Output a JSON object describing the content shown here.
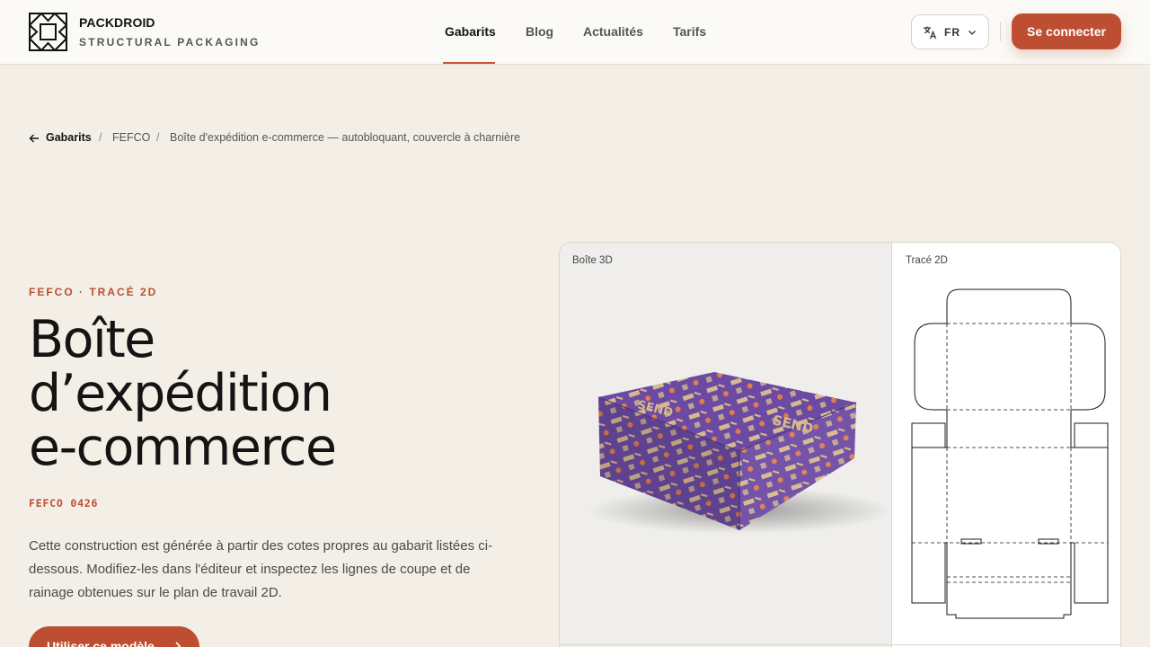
{
  "brand": {
    "name": "PACKDROID",
    "subtitle": "STRUCTURAL PACKAGING"
  },
  "nav": {
    "items": [
      {
        "label": "Gabarits",
        "active": true
      },
      {
        "label": "Blog",
        "active": false
      },
      {
        "label": "Actualités",
        "active": false
      },
      {
        "label": "Tarifs",
        "active": false
      }
    ],
    "language": "FR",
    "login_label": "Se connecter"
  },
  "breadcrumb": {
    "items": [
      "Gabarits",
      "FEFCO",
      "Boîte d'expédition e-commerce — autobloquant, couvercle à charnière"
    ]
  },
  "hero": {
    "eyebrow": "FEFCO · TRACÉ 2D",
    "title_lines": [
      "Boîte",
      "d’expédition",
      "e-commerce"
    ],
    "code": "FEFCO 0426",
    "description": "Cette construction est générée à partir des cotes propres au gabarit listées ci-dessous. Modifiez-les dans l'éditeur et inspectez les lignes de coupe et de rainage obtenues sur le plan de travail 2D.",
    "cta_label": "Utiliser ce modèle"
  },
  "preview": {
    "label_3d": "Boîte 3D",
    "label_2d": "Tracé 2D",
    "box_print_text": "SEND"
  },
  "colors": {
    "accent": "#bd4e32",
    "background": "#f3efe6",
    "box_purple": "#6b4aa3",
    "box_kraft": "#d6b98e"
  }
}
